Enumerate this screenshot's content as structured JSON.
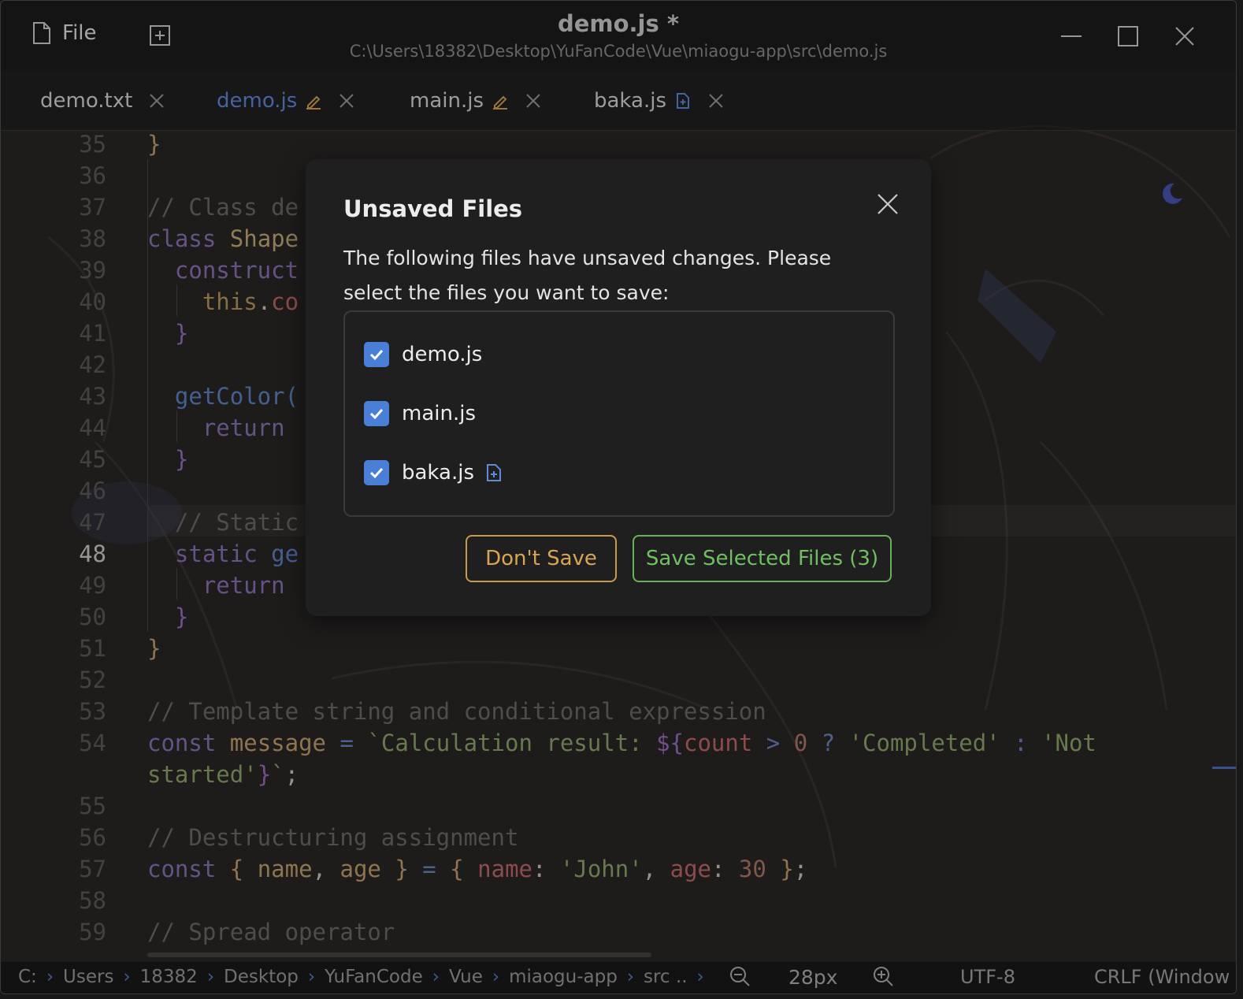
{
  "window": {
    "menu_label": "File",
    "title": "demo.js *",
    "path": "C:\\Users\\18382\\Desktop\\YuFanCode\\Vue\\miaogu-app\\src\\demo.js"
  },
  "tabs": [
    {
      "label": "demo.txt",
      "state": "saved"
    },
    {
      "label": "demo.js",
      "state": "modified",
      "active": true
    },
    {
      "label": "main.js",
      "state": "modified"
    },
    {
      "label": "baka.js",
      "state": "new"
    }
  ],
  "editor": {
    "current_line": 48,
    "line_numbers": [
      "35",
      "36",
      "37",
      "38",
      "39",
      "40",
      "41",
      "42",
      "43",
      "44",
      "45",
      "46",
      "47",
      "48",
      "49",
      "50",
      "51",
      "52",
      "53",
      "54",
      "",
      "55",
      "56",
      "57",
      "58",
      "59"
    ]
  },
  "dialog": {
    "title": "Unsaved Files",
    "message": "The following files have unsaved changes. Please select the files you want to save:",
    "files": [
      {
        "name": "demo.js",
        "checked": true,
        "badge": ""
      },
      {
        "name": "main.js",
        "checked": true,
        "badge": ""
      },
      {
        "name": "baka.js",
        "checked": true,
        "badge": "new-file-icon"
      }
    ],
    "dont_save_label": "Don't Save",
    "save_label": "Save Selected Files (3)"
  },
  "statusbar": {
    "breadcrumbs": [
      "C:",
      "Users",
      "18382",
      "Desktop",
      "YuFanCode",
      "Vue",
      "miaogu-app",
      "src .."
    ],
    "zoom": "28px",
    "encoding": "UTF-8",
    "line_ending": "CRLF (Window"
  },
  "colors": {
    "accent": "#4a7fd8",
    "dont_save": "#d9a552",
    "save": "#70c060",
    "modified_tab": "#d9a552"
  }
}
